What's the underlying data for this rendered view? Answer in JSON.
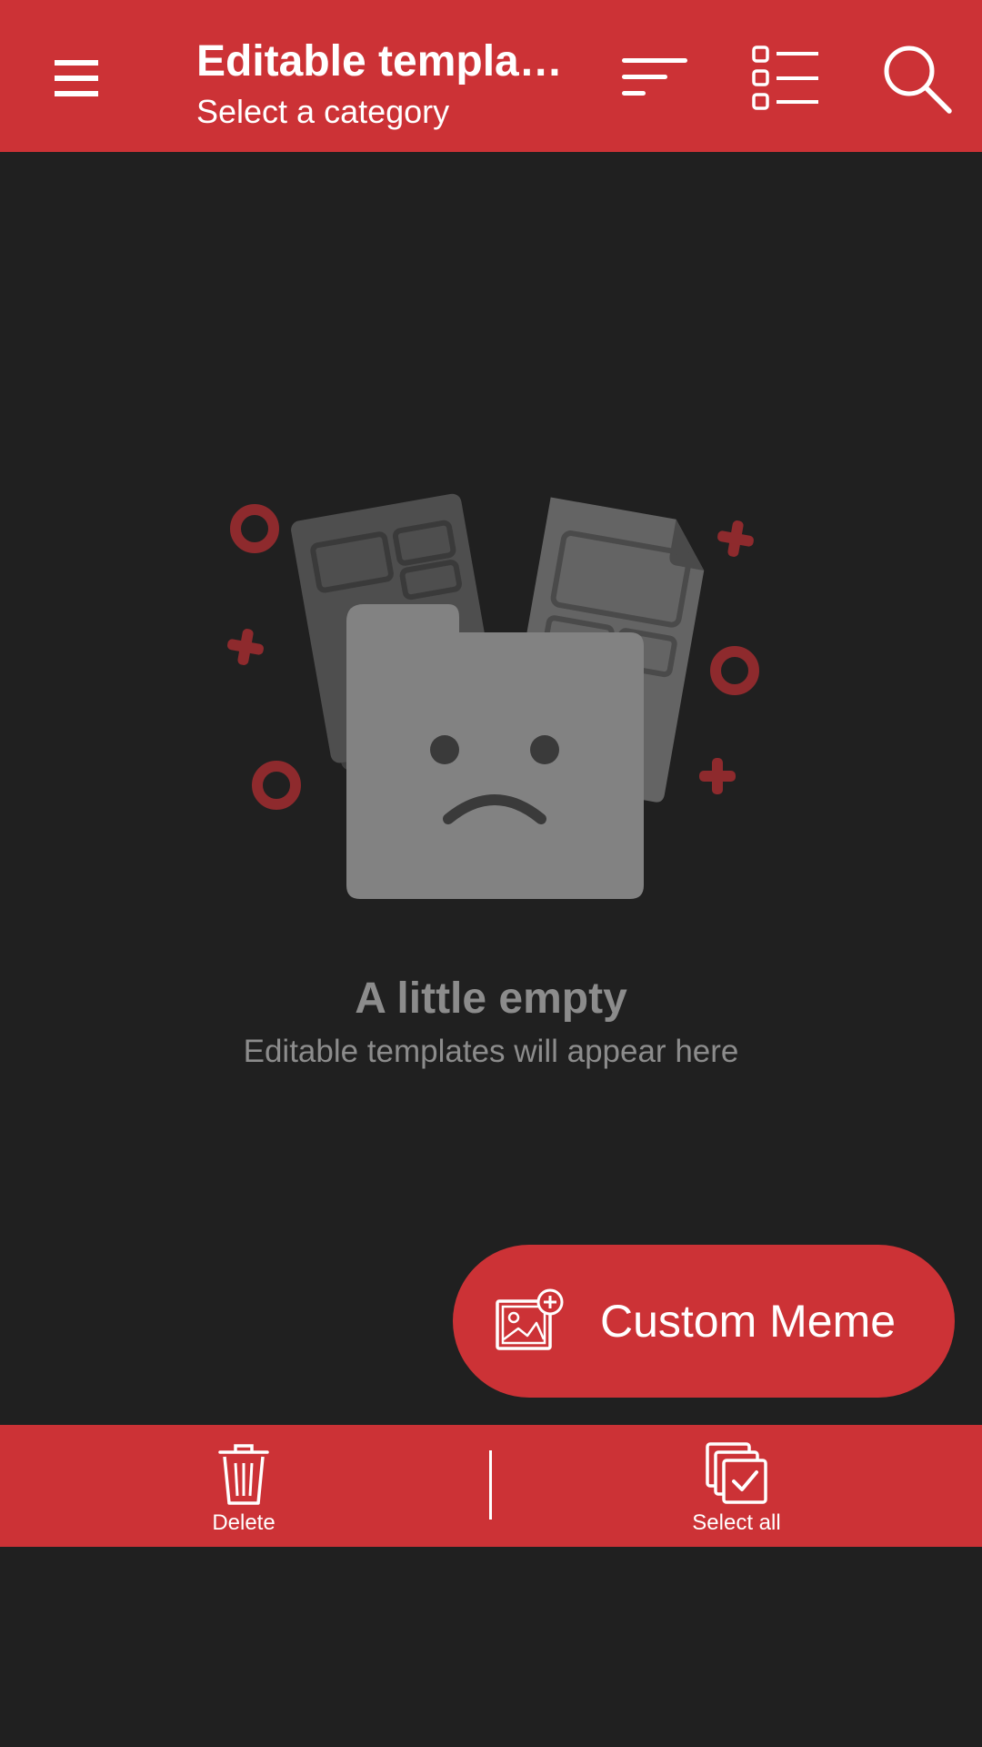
{
  "appbar": {
    "title": "Editable templa…",
    "subtitle": "Select a category",
    "icons": [
      "menu-icon",
      "sort-icon",
      "list-view-icon",
      "search-icon"
    ]
  },
  "empty_state": {
    "title": "A little empty",
    "subtitle": "Editable templates will appear here",
    "illustration": "sad-folder-illustration"
  },
  "fab": {
    "label": "Custom Meme",
    "icon": "add-image-icon"
  },
  "actionbar": {
    "delete_label": "Delete",
    "select_all_label": "Select all",
    "icons": [
      "trash-icon",
      "select-all-icon"
    ]
  },
  "colors": {
    "primary": "#CC3236",
    "background": "#202020",
    "muted_text": "#8C8C8C",
    "accent_dark_red": "#8E2A2D"
  }
}
